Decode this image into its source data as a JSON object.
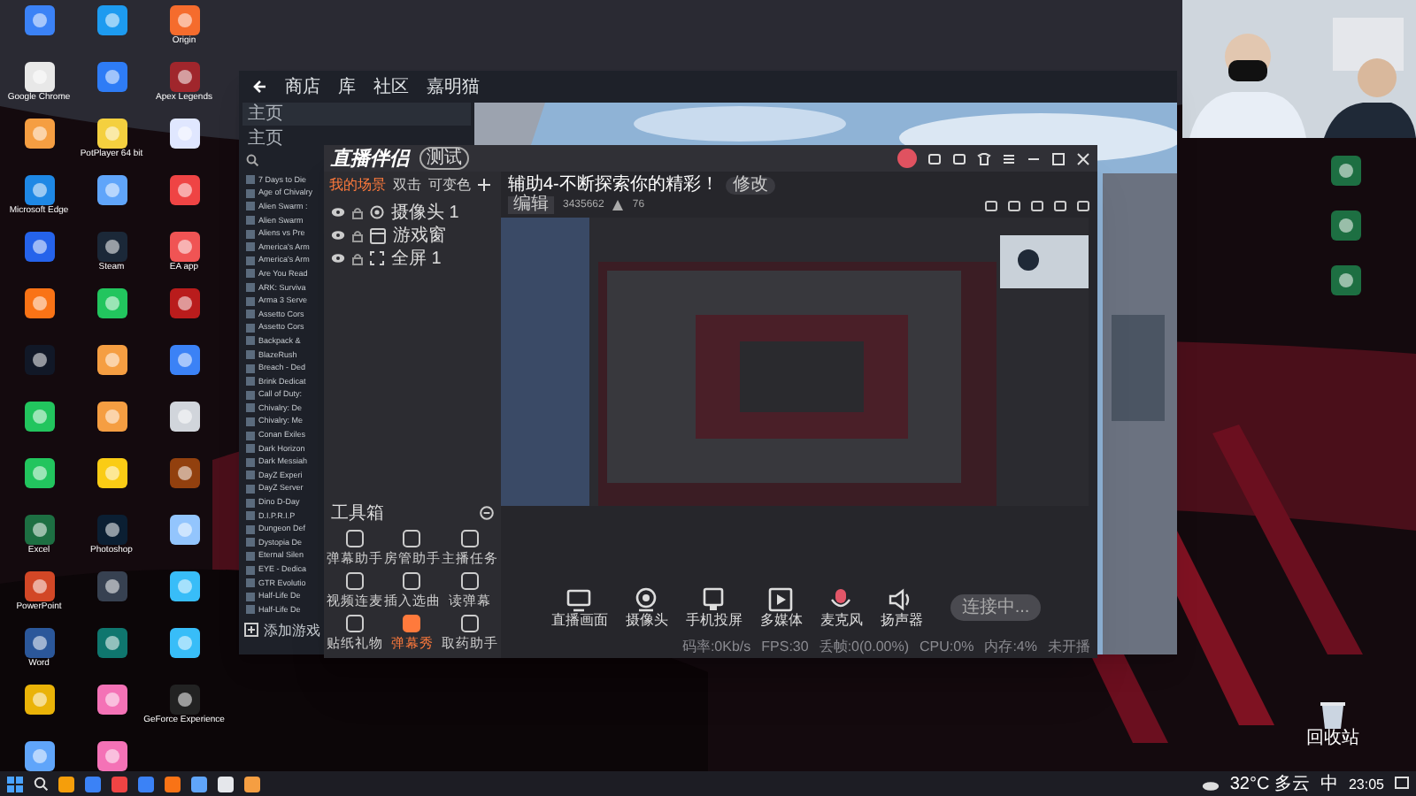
{
  "desktop_left": [
    {
      "kind": "pc"
    },
    {
      "kind": "wifi"
    },
    {
      "kind": "origin",
      "label": "Origin"
    },
    {
      "kind": "chrome",
      "label": "Google Chrome"
    },
    {
      "kind": "kapp"
    },
    {
      "kind": "apex",
      "label": "Apex Legends"
    },
    {
      "kind": "orange"
    },
    {
      "kind": "potplayer",
      "label": "PotPlayer 64 bit"
    },
    {
      "kind": "white"
    },
    {
      "kind": "edge",
      "label": "Microsoft Edge"
    },
    {
      "kind": "bird"
    },
    {
      "kind": "redx"
    },
    {
      "kind": "shield"
    },
    {
      "kind": "steam",
      "label": "Steam"
    },
    {
      "kind": "ea",
      "label": "EA app"
    },
    {
      "kind": "colorful"
    },
    {
      "kind": "greenball"
    },
    {
      "kind": "redavatar"
    },
    {
      "kind": "penguin"
    },
    {
      "kind": "orange"
    },
    {
      "kind": "blueplay"
    },
    {
      "kind": "play"
    },
    {
      "kind": "orange"
    },
    {
      "kind": "figure"
    },
    {
      "kind": "wechat"
    },
    {
      "kind": "folder"
    },
    {
      "kind": "brown"
    },
    {
      "kind": "excel",
      "label": "Excel"
    },
    {
      "kind": "photoshop",
      "label": "Photoshop"
    },
    {
      "kind": "paleblue"
    },
    {
      "kind": "powerpoint",
      "label": "PowerPoint"
    },
    {
      "kind": "dark"
    },
    {
      "kind": "bluecircle"
    },
    {
      "kind": "word",
      "label": "Word"
    },
    {
      "kind": "teal"
    },
    {
      "kind": "bluecircle"
    },
    {
      "kind": "yellow"
    },
    {
      "kind": "pink"
    },
    {
      "kind": "geforce",
      "label": "GeForce Experience"
    },
    {
      "kind": "cloud"
    },
    {
      "kind": "pink"
    }
  ],
  "desktop_right": [
    {
      "kind": "excel"
    },
    {
      "kind": "excel"
    },
    {
      "kind": "excel"
    },
    {
      "kind": "bin",
      "label": "回收站"
    }
  ],
  "steam": {
    "nav": [
      "商店",
      "库",
      "社区",
      "嘉明猫"
    ],
    "home": "主页",
    "filter": "主页",
    "games": [
      "7 Days to Die",
      "Age of Chivalry",
      "Alien Swarm :",
      "Alien Swarm",
      "Aliens vs Pre",
      "America's Arm",
      "America's Arm",
      "Are You Read",
      "ARK: Surviva",
      "Arma 3 Serve",
      "Assetto Cors",
      "Assetto Cors",
      "Backpack &",
      "BlazeRush",
      "Breach - Ded",
      "Brink Dedicat",
      "Call of Duty:",
      "Chivalry: De",
      "Chivalry: Me",
      "Conan Exiles",
      "Dark Horizon",
      "Dark Messiah",
      "DayZ Experi",
      "DayZ Server",
      "Dino D-Day",
      "D.I.P.R.I.P",
      "Dungeon Def",
      "Dystopia De",
      "Eternal Silen",
      "EYE - Dedica",
      "GTR Evolutio",
      "Half-Life De",
      "Half-Life De"
    ],
    "add_game": "添加游戏"
  },
  "live": {
    "logo": "直播伴侣",
    "version": "测试",
    "tabs": [
      {
        "label": "我的场景",
        "selected": true
      },
      {
        "label": "双击",
        "selected": false
      },
      {
        "label": "可变色",
        "selected": false
      }
    ],
    "sources": [
      {
        "label": "摄像头 1",
        "kind": "camera"
      },
      {
        "label": "游戏窗",
        "kind": "window"
      },
      {
        "label": "全屏 1",
        "kind": "screen"
      }
    ],
    "tools_title": "工具箱",
    "tools": [
      {
        "label": "弹幕助手",
        "highlight": false
      },
      {
        "label": "房管助手",
        "highlight": false
      },
      {
        "label": "主播任务",
        "highlight": false
      },
      {
        "label": "视频连麦",
        "highlight": false
      },
      {
        "label": "插入选曲",
        "highlight": false
      },
      {
        "label": "读弹幕",
        "highlight": false
      },
      {
        "label": "贴纸礼物",
        "highlight": false
      },
      {
        "label": "弹幕秀",
        "highlight": true
      },
      {
        "label": "取药助手",
        "highlight": false
      }
    ],
    "room_title": "辅助4-不断探索你的精彩！",
    "edit_title": "修改",
    "edit": "编辑",
    "room_id": "3435662",
    "fans": "76",
    "controls": [
      {
        "label": "直播画面",
        "kind": "screen"
      },
      {
        "label": "摄像头",
        "kind": "camera"
      },
      {
        "label": "手机投屏",
        "kind": "phone"
      },
      {
        "label": "多媒体",
        "kind": "media"
      },
      {
        "label": "麦克风",
        "kind": "mic"
      },
      {
        "label": "扬声器",
        "kind": "speaker"
      }
    ],
    "start": "连接中...",
    "status": [
      "码率:0Kb/s",
      "FPS:30",
      "丢帧:0(0.00%)",
      "CPU:0%",
      "内存:4%",
      "未开播"
    ]
  },
  "taskbar": {
    "weather": "32°C 多云",
    "ime": "中",
    "time": "23:05"
  }
}
